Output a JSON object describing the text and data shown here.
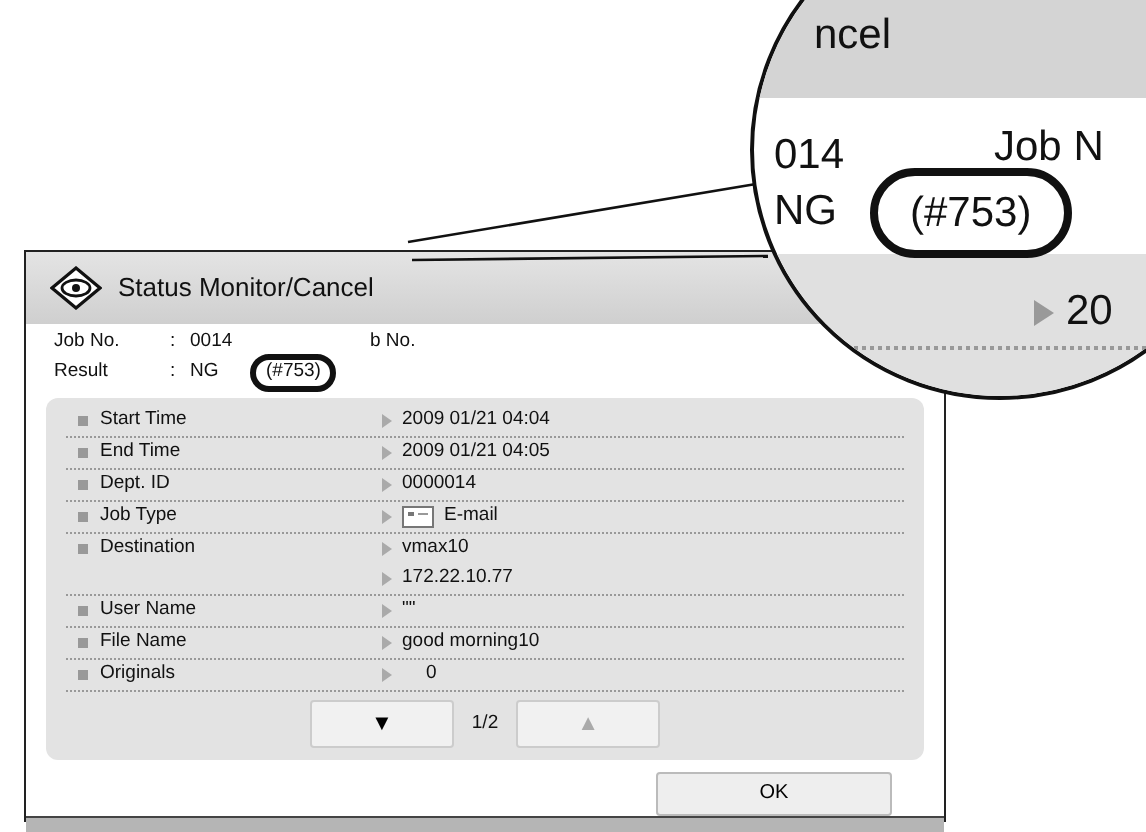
{
  "window": {
    "title": "Status Monitor/Cancel"
  },
  "header": [
    {
      "label": "Job No.",
      "separator": ":",
      "value": "0014"
    },
    {
      "label": "Result",
      "separator": ":",
      "value": "NG",
      "code": "(#753)"
    }
  ],
  "header_extra": {
    "label": "b No."
  },
  "details": [
    {
      "label": "Start Time",
      "kind": "text",
      "values": [
        "2009 01/21 04:04"
      ]
    },
    {
      "label": "End Time",
      "kind": "text",
      "values": [
        "2009 01/21 04:05"
      ]
    },
    {
      "label": "Dept. ID",
      "kind": "text",
      "values": [
        "0000014"
      ]
    },
    {
      "label": "Job Type",
      "kind": "email",
      "values": [
        "E-mail"
      ]
    },
    {
      "label": "Destination",
      "kind": "text",
      "values": [
        "vmax10",
        "172.22.10.77"
      ]
    },
    {
      "label": "User Name",
      "kind": "text",
      "values": [
        "\"\""
      ]
    },
    {
      "label": "File Name",
      "kind": "text",
      "values": [
        "good morning10"
      ]
    },
    {
      "label": "Originals",
      "kind": "count",
      "values": [
        "0"
      ]
    }
  ],
  "pager": {
    "down": {
      "label": "▼",
      "disabled": false
    },
    "page": "1/2",
    "up": {
      "label": "▲",
      "disabled": true
    }
  },
  "ok_button": "OK",
  "magnifier": {
    "title": "ncel",
    "job_no": "014",
    "result": "NG",
    "code": "(#753)",
    "job_label": "Job N",
    "value": "20"
  }
}
